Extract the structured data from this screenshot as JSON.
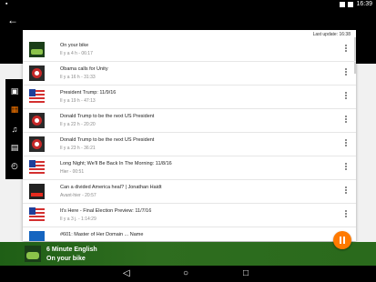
{
  "status": {
    "time": "16:39"
  },
  "card": {
    "last_update": "Last update: 16:38"
  },
  "episodes": [
    {
      "title": "On your bike",
      "meta": "Il y a 4 h - 06:17",
      "thumb": "6-minute-english"
    },
    {
      "title": "Obama calls for Unity",
      "meta": "Il y a 16 h - 31:33",
      "thumb": "newshour"
    },
    {
      "title": "President Trump: 11/9/16",
      "meta": "Il y a 19 h - 47:13",
      "thumb": "flag"
    },
    {
      "title": "Donald Trump to be the next US President",
      "meta": "Il y a 22 h - 20:20",
      "thumb": "newshour"
    },
    {
      "title": "Donald Trump to be the next US President",
      "meta": "Il y a 23 h - 36:21",
      "thumb": "newshour"
    },
    {
      "title": "Long Night; We'll Be Back In The Morning: 11/8/16",
      "meta": "Hier - 00:51",
      "thumb": "flag"
    },
    {
      "title": "Can a divided America heal? | Jonathan Haidt",
      "meta": "Avant-hier - 20:57",
      "thumb": "ted"
    },
    {
      "title": "It's Here - Final Election Preview: 11/7/16",
      "meta": "Il y a 3 j. - 1:14:29",
      "thumb": "flag"
    },
    {
      "title": "#601: Master of Her Domain ... Name",
      "meta": "",
      "thumb": "tal"
    }
  ],
  "player": {
    "show": "6 Minute English",
    "episode": "On your bike"
  },
  "colors": {
    "accent": "#ff7a00",
    "player_bg": "#2e6d1f"
  }
}
